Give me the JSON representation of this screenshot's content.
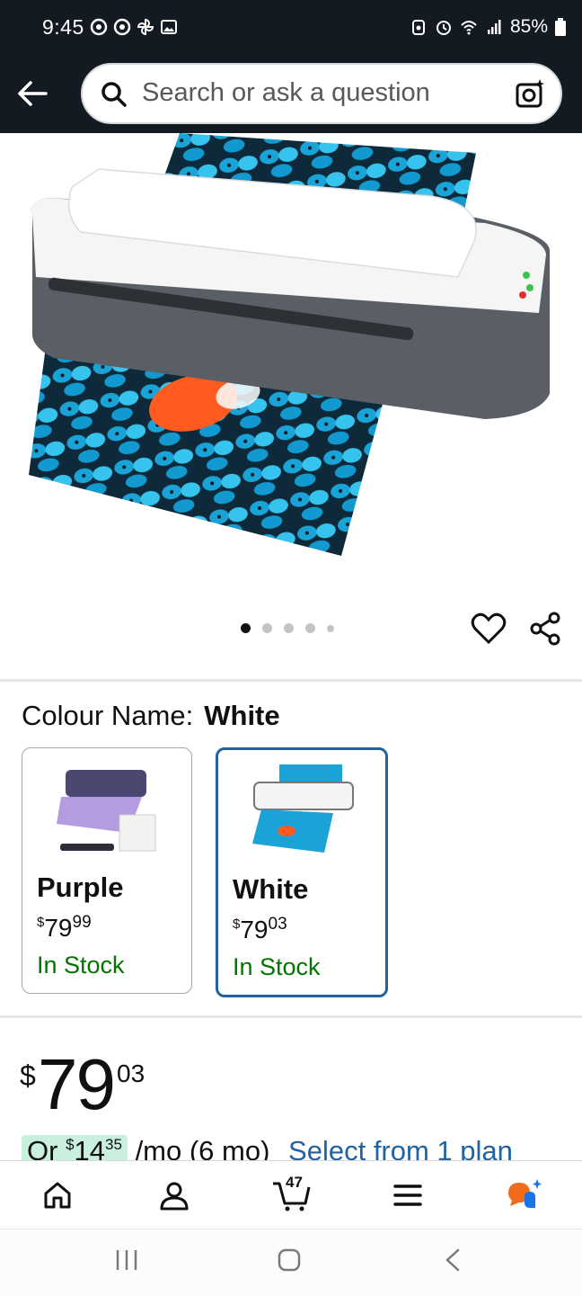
{
  "status_bar": {
    "time": "9:45",
    "battery": "85%"
  },
  "header": {
    "search_placeholder": "Search or ask a question"
  },
  "product_image": {
    "slide_count": 5,
    "active_slide": 1
  },
  "variant": {
    "label": "Colour Name:",
    "selected": "White",
    "options": [
      {
        "name": "Purple",
        "currency": "$",
        "whole": "79",
        "cents": "99",
        "stock": "In Stock",
        "selected": false
      },
      {
        "name": "White",
        "currency": "$",
        "whole": "79",
        "cents": "03",
        "stock": "In Stock",
        "selected": true
      }
    ]
  },
  "price": {
    "currency": "$",
    "whole": "79",
    "cents": "03"
  },
  "installment": {
    "prefix": "Or",
    "currency": "$",
    "whole": "14",
    "cents": "35",
    "suffix": "/mo (6 mo)",
    "link": "Select from 1 plan"
  },
  "bottom_nav": {
    "cart_count": "47"
  },
  "colors": {
    "header_bg": "#131a22",
    "link": "#2162a1",
    "in_stock": "#007600",
    "selected_border": "#2162a1"
  }
}
